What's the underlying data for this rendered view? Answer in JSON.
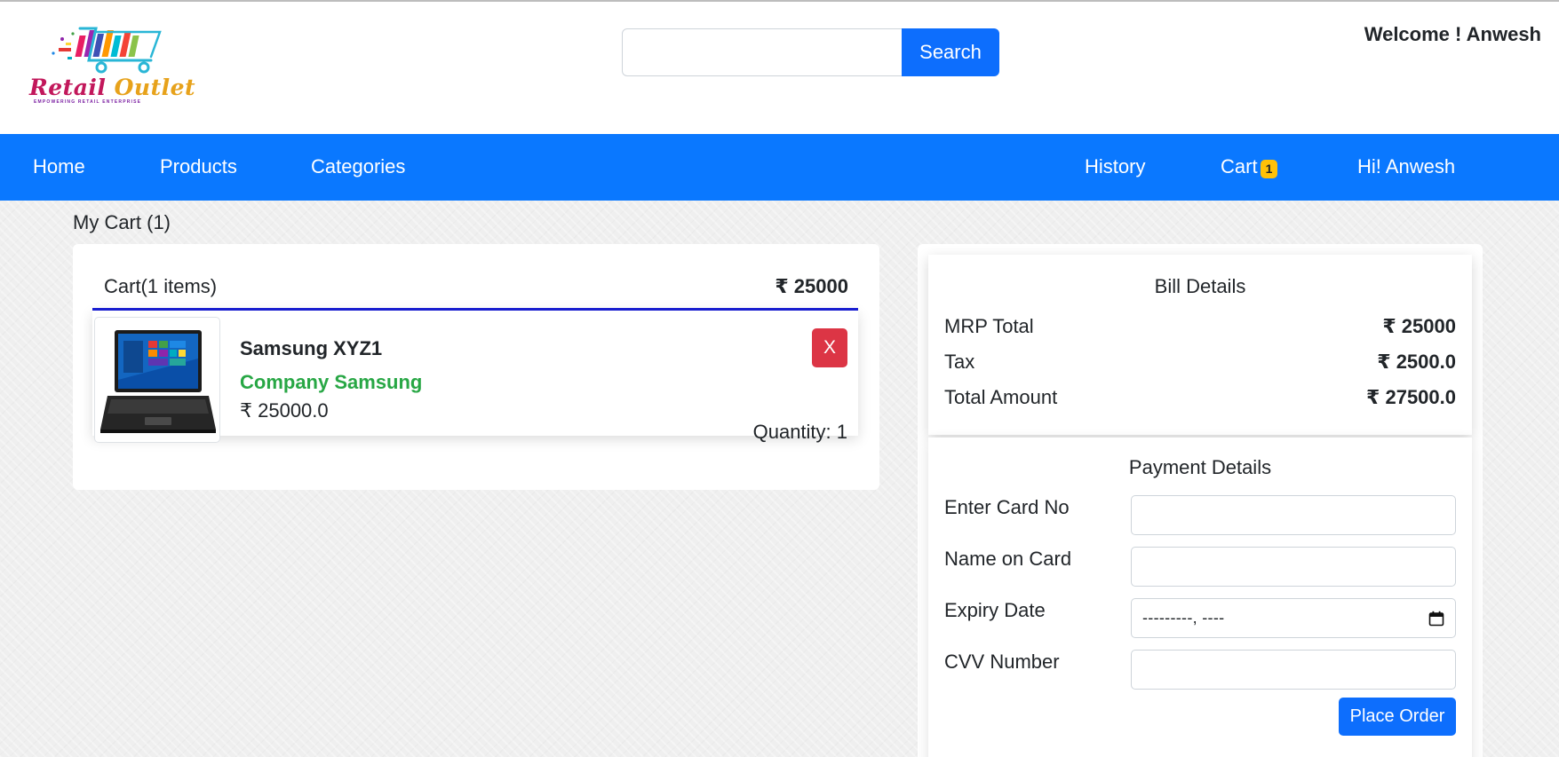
{
  "header": {
    "logo": {
      "title_part1": "Retail ",
      "title_part2": "Outlet",
      "tagline": "EMPOWERING RETAIL ENTERPRISE"
    },
    "search": {
      "value": "",
      "placeholder": "",
      "button_label": "Search"
    },
    "welcome_text": "Welcome ! Anwesh"
  },
  "nav": {
    "left": [
      {
        "label": "Home"
      },
      {
        "label": "Products"
      },
      {
        "label": "Categories"
      }
    ],
    "history": "History",
    "cart": {
      "label": "Cart",
      "badge": "1"
    },
    "user": "Hi! Anwesh"
  },
  "cart": {
    "page_title": "My Cart (1)",
    "header_label": "Cart(1 items)",
    "header_total": "₹ 25000",
    "items": [
      {
        "image_icon": "laptop-icon",
        "name": "Samsung XYZ1",
        "company": "Company Samsung",
        "price": "₹ 25000.0",
        "remove_label": "X",
        "quantity": "Quantity: 1"
      }
    ]
  },
  "bill": {
    "title": "Bill Details",
    "rows": [
      {
        "label": "MRP Total",
        "value": "₹ 25000"
      },
      {
        "label": "Tax",
        "value": "₹ 2500.0"
      },
      {
        "label": "Total Amount",
        "value": "₹ 27500.0"
      }
    ]
  },
  "payment": {
    "title": "Payment Details",
    "fields": [
      {
        "label": "Enter Card No",
        "value": ""
      },
      {
        "label": "Name on Card",
        "value": ""
      },
      {
        "label": "Expiry Date",
        "value": "---------, ----"
      },
      {
        "label": "CVV Number",
        "value": ""
      }
    ],
    "submit_label": "Place Order"
  },
  "colors": {
    "primary": "#0d6efd",
    "nav_bg": "#0a78ff",
    "danger": "#dc3545",
    "success": "#28a745",
    "badge": "#ffc107",
    "divider": "#1a1fd6"
  }
}
